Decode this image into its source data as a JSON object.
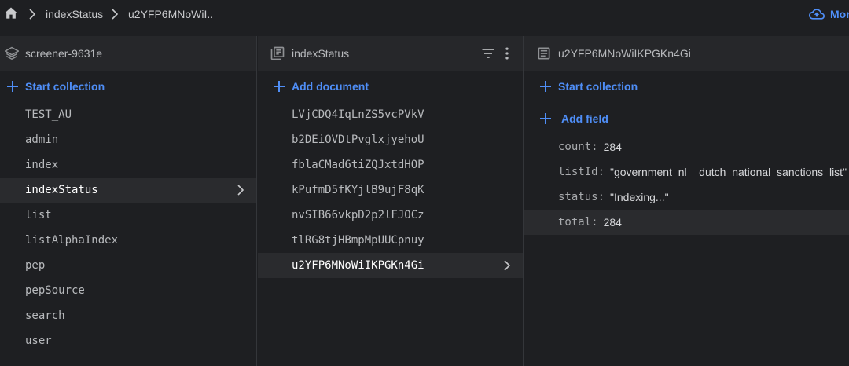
{
  "breadcrumb": {
    "items": [
      "indexStatus",
      "u2YFP6MNoWiI.."
    ],
    "more_label": "Mor"
  },
  "panels": {
    "root": {
      "title": "screener-9631e",
      "action_label": "Start collection",
      "collections": [
        "TEST_AU",
        "admin",
        "index",
        "indexStatus",
        "list",
        "listAlphaIndex",
        "pep",
        "pepSource",
        "search",
        "user"
      ],
      "selected": "indexStatus"
    },
    "collection": {
      "title": "indexStatus",
      "action_label": "Add document",
      "documents": [
        "LVjCDQ4IqLnZS5vcPVkV",
        "b2DEiOVDtPvglxjyehoU",
        "fblaCMad6tiZQJxtdHOP",
        "kPufmD5fKYjlB9ujF8qK",
        "nvSIB66vkpD2p2lFJOCz",
        "tlRG8tjHBmpMpUUCpnuy",
        "u2YFP6MNoWiIKPGKn4Gi"
      ],
      "selected": "u2YFP6MNoWiIKPGKn4Gi"
    },
    "document": {
      "title": "u2YFP6MNoWiIKPGKn4Gi",
      "start_collection_label": "Start collection",
      "add_field_label": "Add field",
      "fields": [
        {
          "key": "count:",
          "value": "284"
        },
        {
          "key": "listId:",
          "value": "\"government_nl__dutch_national_sanctions_list\""
        },
        {
          "key": "status:",
          "value": "\"Indexing...\""
        },
        {
          "key": "total:",
          "value": "284"
        }
      ]
    }
  },
  "colors": {
    "accent": "#4f8ef7",
    "background": "#1e1f22",
    "header": "#26272a",
    "selected": "#2a2b2e"
  }
}
